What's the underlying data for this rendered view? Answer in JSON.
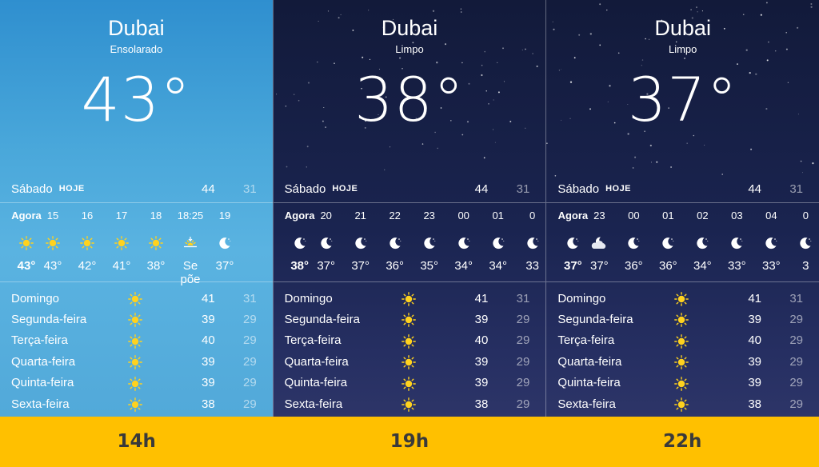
{
  "panels": [
    {
      "theme": "day",
      "city": "Dubai",
      "condition": "Ensolarado",
      "current_temp": "43°",
      "today": {
        "day": "Sábado",
        "tag": "HOJE",
        "high": "44",
        "low": "31"
      },
      "hourly": [
        {
          "time": "Agora",
          "icon": "sun-icon",
          "temp": "43°"
        },
        {
          "time": "15",
          "icon": "sun-icon",
          "temp": "43°"
        },
        {
          "time": "16",
          "icon": "sun-icon",
          "temp": "42°"
        },
        {
          "time": "17",
          "icon": "sun-icon",
          "temp": "41°"
        },
        {
          "time": "18",
          "icon": "sun-icon",
          "temp": "38°"
        },
        {
          "time": "18:25",
          "icon": "sunset-icon",
          "temp": "Se põe"
        },
        {
          "time": "19",
          "icon": "moon-icon",
          "temp": "37°"
        }
      ],
      "daily": [
        {
          "day": "Domingo",
          "icon": "sun-icon",
          "high": "41",
          "low": "31"
        },
        {
          "day": "Segunda-feira",
          "icon": "sun-icon",
          "high": "39",
          "low": "29"
        },
        {
          "day": "Terça-feira",
          "icon": "sun-icon",
          "high": "40",
          "low": "29"
        },
        {
          "day": "Quarta-feira",
          "icon": "sun-icon",
          "high": "39",
          "low": "29"
        },
        {
          "day": "Quinta-feira",
          "icon": "sun-icon",
          "high": "39",
          "low": "29"
        },
        {
          "day": "Sexta-feira",
          "icon": "sun-icon",
          "high": "38",
          "low": "29"
        }
      ]
    },
    {
      "theme": "night",
      "city": "Dubai",
      "condition": "Limpo",
      "current_temp": "38°",
      "today": {
        "day": "Sábado",
        "tag": "HOJE",
        "high": "44",
        "low": "31"
      },
      "hourly": [
        {
          "time": "Agora",
          "icon": "moon-icon",
          "temp": "38°"
        },
        {
          "time": "20",
          "icon": "moon-icon",
          "temp": "37°"
        },
        {
          "time": "21",
          "icon": "moon-icon",
          "temp": "37°"
        },
        {
          "time": "22",
          "icon": "moon-icon",
          "temp": "36°"
        },
        {
          "time": "23",
          "icon": "moon-icon",
          "temp": "35°"
        },
        {
          "time": "00",
          "icon": "moon-icon",
          "temp": "34°"
        },
        {
          "time": "01",
          "icon": "moon-icon",
          "temp": "34°"
        },
        {
          "time": "0",
          "icon": "moon-icon",
          "temp": "33"
        }
      ],
      "daily": [
        {
          "day": "Domingo",
          "icon": "sun-icon",
          "high": "41",
          "low": "31"
        },
        {
          "day": "Segunda-feira",
          "icon": "sun-icon",
          "high": "39",
          "low": "29"
        },
        {
          "day": "Terça-feira",
          "icon": "sun-icon",
          "high": "40",
          "low": "29"
        },
        {
          "day": "Quarta-feira",
          "icon": "sun-icon",
          "high": "39",
          "low": "29"
        },
        {
          "day": "Quinta-feira",
          "icon": "sun-icon",
          "high": "39",
          "low": "29"
        },
        {
          "day": "Sexta-feira",
          "icon": "sun-icon",
          "high": "38",
          "low": "29"
        }
      ]
    },
    {
      "theme": "night",
      "city": "Dubai",
      "condition": "Limpo",
      "current_temp": "37°",
      "today": {
        "day": "Sábado",
        "tag": "HOJE",
        "high": "44",
        "low": "31"
      },
      "hourly": [
        {
          "time": "Agora",
          "icon": "moon-icon",
          "temp": "37°"
        },
        {
          "time": "23",
          "icon": "moon-cloud-icon",
          "temp": "37°"
        },
        {
          "time": "00",
          "icon": "moon-icon",
          "temp": "36°"
        },
        {
          "time": "01",
          "icon": "moon-icon",
          "temp": "36°"
        },
        {
          "time": "02",
          "icon": "moon-icon",
          "temp": "34°"
        },
        {
          "time": "03",
          "icon": "moon-icon",
          "temp": "33°"
        },
        {
          "time": "04",
          "icon": "moon-icon",
          "temp": "33°"
        },
        {
          "time": "0",
          "icon": "moon-icon",
          "temp": "3"
        }
      ],
      "daily": [
        {
          "day": "Domingo",
          "icon": "sun-icon",
          "high": "41",
          "low": "31"
        },
        {
          "day": "Segunda-feira",
          "icon": "sun-icon",
          "high": "39",
          "low": "29"
        },
        {
          "day": "Terça-feira",
          "icon": "sun-icon",
          "high": "40",
          "low": "29"
        },
        {
          "day": "Quarta-feira",
          "icon": "sun-icon",
          "high": "39",
          "low": "29"
        },
        {
          "day": "Quinta-feira",
          "icon": "sun-icon",
          "high": "39",
          "low": "29"
        },
        {
          "day": "Sexta-feira",
          "icon": "sun-icon",
          "high": "38",
          "low": "29"
        }
      ]
    }
  ],
  "footer": {
    "labels": [
      "14h",
      "19h",
      "22h"
    ]
  },
  "colors": {
    "sun": "#ffd21e",
    "banner": "#ffc000",
    "day_sky": "#49a7da",
    "night_sky": "#1a2450"
  }
}
